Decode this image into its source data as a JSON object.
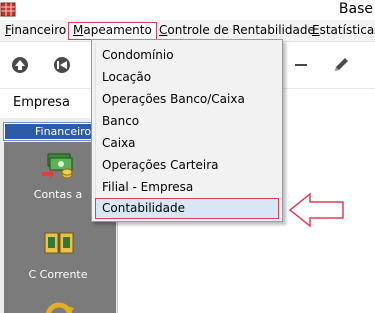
{
  "titlebar": {
    "title": "Base"
  },
  "menubar": {
    "items": [
      {
        "label_first": "F",
        "label_rest": "inanceiro"
      },
      {
        "label_first": "M",
        "label_rest": "apeamento"
      },
      {
        "label_first": "C",
        "label_rest": "ontrole de Rentabilidade"
      },
      {
        "label_first": "E",
        "label_rest": "statísticas"
      }
    ]
  },
  "filter": {
    "empresa_label": "Empresa"
  },
  "sidebar": {
    "tab_label": "Financeiro",
    "items": [
      {
        "label": "Contas a",
        "icon": "money-icon"
      },
      {
        "label": "C Corrente",
        "icon": "ledger-icon"
      },
      {
        "icon": "refresh-icon"
      }
    ]
  },
  "dropdown": {
    "items": [
      "Condomínio",
      "Locação",
      "Operações Banco/Caixa",
      "Banco",
      "Caixa",
      "Operações Carteira",
      "Filial - Empresa",
      "Contabilidade"
    ],
    "selected_index": 7
  },
  "colors": {
    "highlight_border": "#e23d57",
    "selected_bg": "#d9e6f5",
    "sidebar_tab": "#2c5ba7",
    "sidebar_panel": "#7b7b7b"
  }
}
